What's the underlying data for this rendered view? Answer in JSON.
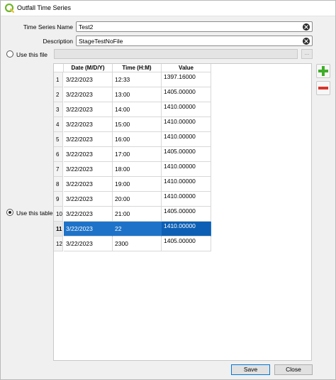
{
  "window": {
    "title": "Outfall Time Series"
  },
  "form": {
    "name_label": "Time Series Name",
    "name_value": "Test2",
    "description_label": "Description",
    "description_value": "StageTestNoFile",
    "use_file_label": "Use this file",
    "browse_label": "...",
    "use_table_label": "Use this table"
  },
  "table": {
    "headers": [
      "Date (M/D/Y)",
      "Time (H:M)",
      "Value"
    ],
    "rows": [
      {
        "num": "1",
        "date": "3/22/2023",
        "time": "12:33",
        "value": "1397.16000"
      },
      {
        "num": "2",
        "date": "3/22/2023",
        "time": "13:00",
        "value": "1405.00000"
      },
      {
        "num": "3",
        "date": "3/22/2023",
        "time": "14:00",
        "value": "1410.00000"
      },
      {
        "num": "4",
        "date": "3/22/2023",
        "time": "15:00",
        "value": "1410.00000"
      },
      {
        "num": "5",
        "date": "3/22/2023",
        "time": "16:00",
        "value": "1410.00000"
      },
      {
        "num": "6",
        "date": "3/22/2023",
        "time": "17:00",
        "value": "1405.00000"
      },
      {
        "num": "7",
        "date": "3/22/2023",
        "time": "18:00",
        "value": "1410.00000"
      },
      {
        "num": "8",
        "date": "3/22/2023",
        "time": "19:00",
        "value": "1410.00000"
      },
      {
        "num": "9",
        "date": "3/22/2023",
        "time": "20:00",
        "value": "1410.00000"
      },
      {
        "num": "10",
        "date": "3/22/2023",
        "time": "21:00",
        "value": "1405.00000"
      },
      {
        "num": "11",
        "date": "3/22/2023",
        "time": "22",
        "value": "1410.00000"
      },
      {
        "num": "12",
        "date": "3/22/2023",
        "time": "2300",
        "value": "1405.00000"
      }
    ],
    "selected_row": "11"
  },
  "icons": {
    "add": "plus-icon",
    "remove": "minus-icon",
    "app": "qgis-icon",
    "clear": "clear-icon"
  },
  "colors": {
    "add": "#3fae2a",
    "remove": "#d9342b",
    "selection": "#1e73c8",
    "app_icon": "#6fb52c"
  },
  "buttons": {
    "save": "Save",
    "close": "Close"
  }
}
